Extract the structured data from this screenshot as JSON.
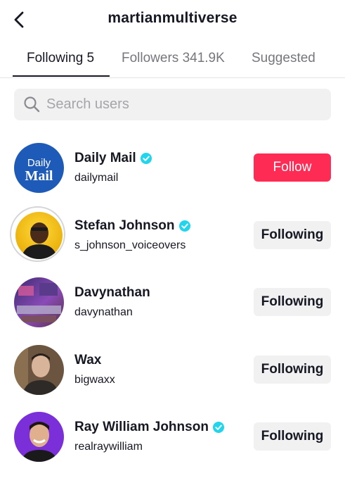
{
  "header": {
    "title": "martianmultiverse",
    "back_icon": "chevron-left-icon"
  },
  "tabs": [
    {
      "label": "Following 5",
      "active": true
    },
    {
      "label": "Followers 341.9K",
      "active": false
    },
    {
      "label": "Suggested",
      "active": false
    }
  ],
  "search": {
    "placeholder": "Search users",
    "value": "",
    "icon": "search-icon"
  },
  "colors": {
    "follow_button": "#fe2c55",
    "verified_badge": "#20d5ec",
    "following_button": "#f1f1f2"
  },
  "users": [
    {
      "name": "Daily Mail",
      "handle": "dailymail",
      "verified": true,
      "button": "Follow",
      "avatar_text_top": "Daily",
      "avatar_text_bottom": "Mail"
    },
    {
      "name": "Stefan Johnson",
      "handle": "s_johnson_voiceovers",
      "verified": true,
      "button": "Following"
    },
    {
      "name": "Davynathan",
      "handle": "davynathan",
      "verified": false,
      "button": "Following"
    },
    {
      "name": "Wax",
      "handle": "bigwaxx",
      "verified": false,
      "button": "Following"
    },
    {
      "name": "Ray William Johnson",
      "handle": "realraywilliam",
      "verified": true,
      "button": "Following"
    }
  ]
}
